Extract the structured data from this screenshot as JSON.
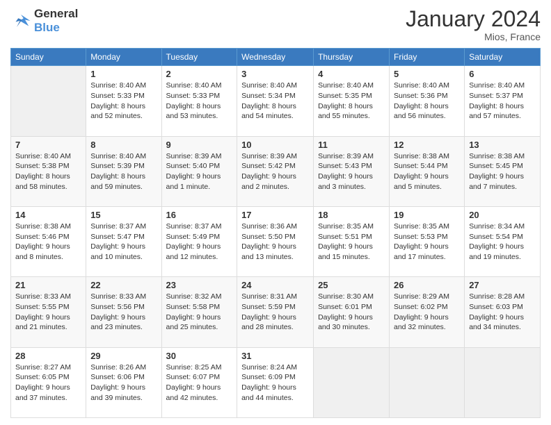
{
  "header": {
    "logo_line1": "General",
    "logo_line2": "Blue",
    "month_title": "January 2024",
    "location": "Mios, France"
  },
  "weekdays": [
    "Sunday",
    "Monday",
    "Tuesday",
    "Wednesday",
    "Thursday",
    "Friday",
    "Saturday"
  ],
  "weeks": [
    [
      {
        "day": "",
        "sunrise": "",
        "sunset": "",
        "daylight": ""
      },
      {
        "day": "1",
        "sunrise": "Sunrise: 8:40 AM",
        "sunset": "Sunset: 5:33 PM",
        "daylight": "Daylight: 8 hours and 52 minutes."
      },
      {
        "day": "2",
        "sunrise": "Sunrise: 8:40 AM",
        "sunset": "Sunset: 5:33 PM",
        "daylight": "Daylight: 8 hours and 53 minutes."
      },
      {
        "day": "3",
        "sunrise": "Sunrise: 8:40 AM",
        "sunset": "Sunset: 5:34 PM",
        "daylight": "Daylight: 8 hours and 54 minutes."
      },
      {
        "day": "4",
        "sunrise": "Sunrise: 8:40 AM",
        "sunset": "Sunset: 5:35 PM",
        "daylight": "Daylight: 8 hours and 55 minutes."
      },
      {
        "day": "5",
        "sunrise": "Sunrise: 8:40 AM",
        "sunset": "Sunset: 5:36 PM",
        "daylight": "Daylight: 8 hours and 56 minutes."
      },
      {
        "day": "6",
        "sunrise": "Sunrise: 8:40 AM",
        "sunset": "Sunset: 5:37 PM",
        "daylight": "Daylight: 8 hours and 57 minutes."
      }
    ],
    [
      {
        "day": "7",
        "sunrise": "Sunrise: 8:40 AM",
        "sunset": "Sunset: 5:38 PM",
        "daylight": "Daylight: 8 hours and 58 minutes."
      },
      {
        "day": "8",
        "sunrise": "Sunrise: 8:40 AM",
        "sunset": "Sunset: 5:39 PM",
        "daylight": "Daylight: 8 hours and 59 minutes."
      },
      {
        "day": "9",
        "sunrise": "Sunrise: 8:39 AM",
        "sunset": "Sunset: 5:40 PM",
        "daylight": "Daylight: 9 hours and 1 minute."
      },
      {
        "day": "10",
        "sunrise": "Sunrise: 8:39 AM",
        "sunset": "Sunset: 5:42 PM",
        "daylight": "Daylight: 9 hours and 2 minutes."
      },
      {
        "day": "11",
        "sunrise": "Sunrise: 8:39 AM",
        "sunset": "Sunset: 5:43 PM",
        "daylight": "Daylight: 9 hours and 3 minutes."
      },
      {
        "day": "12",
        "sunrise": "Sunrise: 8:38 AM",
        "sunset": "Sunset: 5:44 PM",
        "daylight": "Daylight: 9 hours and 5 minutes."
      },
      {
        "day": "13",
        "sunrise": "Sunrise: 8:38 AM",
        "sunset": "Sunset: 5:45 PM",
        "daylight": "Daylight: 9 hours and 7 minutes."
      }
    ],
    [
      {
        "day": "14",
        "sunrise": "Sunrise: 8:38 AM",
        "sunset": "Sunset: 5:46 PM",
        "daylight": "Daylight: 9 hours and 8 minutes."
      },
      {
        "day": "15",
        "sunrise": "Sunrise: 8:37 AM",
        "sunset": "Sunset: 5:47 PM",
        "daylight": "Daylight: 9 hours and 10 minutes."
      },
      {
        "day": "16",
        "sunrise": "Sunrise: 8:37 AM",
        "sunset": "Sunset: 5:49 PM",
        "daylight": "Daylight: 9 hours and 12 minutes."
      },
      {
        "day": "17",
        "sunrise": "Sunrise: 8:36 AM",
        "sunset": "Sunset: 5:50 PM",
        "daylight": "Daylight: 9 hours and 13 minutes."
      },
      {
        "day": "18",
        "sunrise": "Sunrise: 8:35 AM",
        "sunset": "Sunset: 5:51 PM",
        "daylight": "Daylight: 9 hours and 15 minutes."
      },
      {
        "day": "19",
        "sunrise": "Sunrise: 8:35 AM",
        "sunset": "Sunset: 5:53 PM",
        "daylight": "Daylight: 9 hours and 17 minutes."
      },
      {
        "day": "20",
        "sunrise": "Sunrise: 8:34 AM",
        "sunset": "Sunset: 5:54 PM",
        "daylight": "Daylight: 9 hours and 19 minutes."
      }
    ],
    [
      {
        "day": "21",
        "sunrise": "Sunrise: 8:33 AM",
        "sunset": "Sunset: 5:55 PM",
        "daylight": "Daylight: 9 hours and 21 minutes."
      },
      {
        "day": "22",
        "sunrise": "Sunrise: 8:33 AM",
        "sunset": "Sunset: 5:56 PM",
        "daylight": "Daylight: 9 hours and 23 minutes."
      },
      {
        "day": "23",
        "sunrise": "Sunrise: 8:32 AM",
        "sunset": "Sunset: 5:58 PM",
        "daylight": "Daylight: 9 hours and 25 minutes."
      },
      {
        "day": "24",
        "sunrise": "Sunrise: 8:31 AM",
        "sunset": "Sunset: 5:59 PM",
        "daylight": "Daylight: 9 hours and 28 minutes."
      },
      {
        "day": "25",
        "sunrise": "Sunrise: 8:30 AM",
        "sunset": "Sunset: 6:01 PM",
        "daylight": "Daylight: 9 hours and 30 minutes."
      },
      {
        "day": "26",
        "sunrise": "Sunrise: 8:29 AM",
        "sunset": "Sunset: 6:02 PM",
        "daylight": "Daylight: 9 hours and 32 minutes."
      },
      {
        "day": "27",
        "sunrise": "Sunrise: 8:28 AM",
        "sunset": "Sunset: 6:03 PM",
        "daylight": "Daylight: 9 hours and 34 minutes."
      }
    ],
    [
      {
        "day": "28",
        "sunrise": "Sunrise: 8:27 AM",
        "sunset": "Sunset: 6:05 PM",
        "daylight": "Daylight: 9 hours and 37 minutes."
      },
      {
        "day": "29",
        "sunrise": "Sunrise: 8:26 AM",
        "sunset": "Sunset: 6:06 PM",
        "daylight": "Daylight: 9 hours and 39 minutes."
      },
      {
        "day": "30",
        "sunrise": "Sunrise: 8:25 AM",
        "sunset": "Sunset: 6:07 PM",
        "daylight": "Daylight: 9 hours and 42 minutes."
      },
      {
        "day": "31",
        "sunrise": "Sunrise: 8:24 AM",
        "sunset": "Sunset: 6:09 PM",
        "daylight": "Daylight: 9 hours and 44 minutes."
      },
      {
        "day": "",
        "sunrise": "",
        "sunset": "",
        "daylight": ""
      },
      {
        "day": "",
        "sunrise": "",
        "sunset": "",
        "daylight": ""
      },
      {
        "day": "",
        "sunrise": "",
        "sunset": "",
        "daylight": ""
      }
    ]
  ]
}
